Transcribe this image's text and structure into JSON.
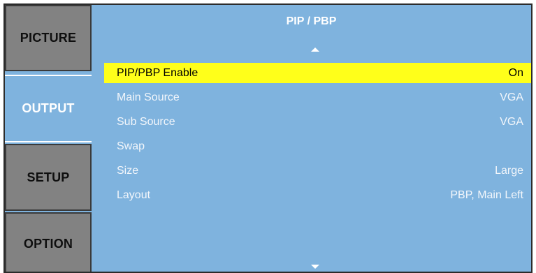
{
  "sidebar": {
    "tabs": [
      {
        "label": "PICTURE",
        "active": false
      },
      {
        "label": "OUTPUT",
        "active": true
      },
      {
        "label": "SETUP",
        "active": false
      },
      {
        "label": "OPTION",
        "active": false
      }
    ]
  },
  "panel": {
    "title": "PIP / PBP",
    "scroll_up_icon": "triangle-up",
    "scroll_down_icon": "triangle-down",
    "rows": [
      {
        "label": "PIP/PBP Enable",
        "value": "On",
        "selected": true
      },
      {
        "label": "Main Source",
        "value": "VGA"
      },
      {
        "label": "Sub Source",
        "value": "VGA"
      },
      {
        "label": "Swap",
        "value": ""
      },
      {
        "label": "Size",
        "value": "Large"
      },
      {
        "label": "Layout",
        "value": "PBP, Main Left"
      }
    ]
  },
  "colors": {
    "panel_bg": "#7fb3de",
    "inactive_tab_bg": "#828282",
    "highlight": "#ffff1a",
    "text_light": "#ffffff"
  }
}
